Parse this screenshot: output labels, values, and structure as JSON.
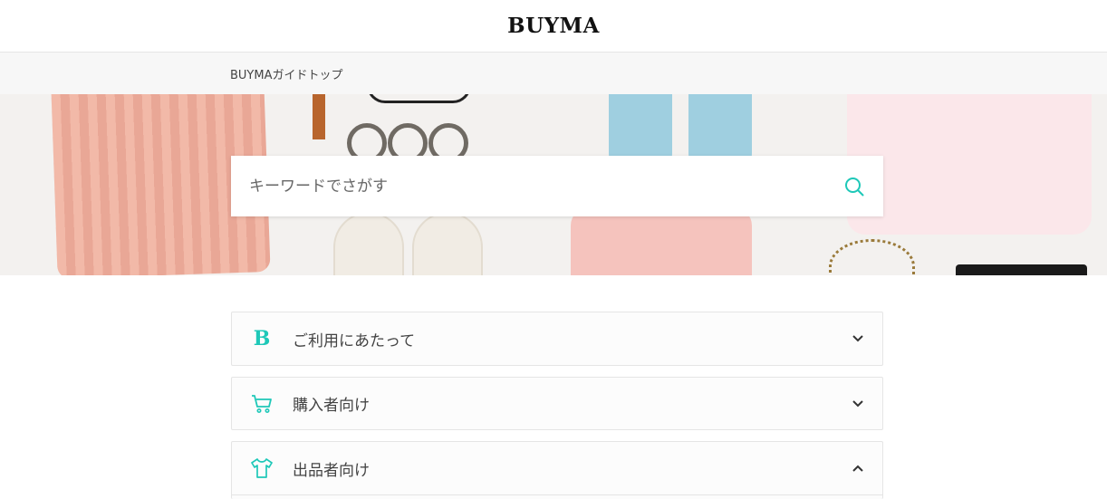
{
  "header": {
    "logo": "BUYMA"
  },
  "breadcrumb": {
    "top_label": "BUYMAガイドトップ"
  },
  "search": {
    "placeholder": "キーワードでさがす",
    "value": ""
  },
  "accent_color": "#1ec8b8",
  "sections": [
    {
      "label": "ご利用にあたって",
      "icon": "b-logo-icon",
      "icon_text": "B",
      "expanded": false
    },
    {
      "label": "購入者向け",
      "icon": "cart-icon",
      "expanded": false
    },
    {
      "label": "出品者向け",
      "icon": "tshirt-icon",
      "expanded": true
    }
  ]
}
